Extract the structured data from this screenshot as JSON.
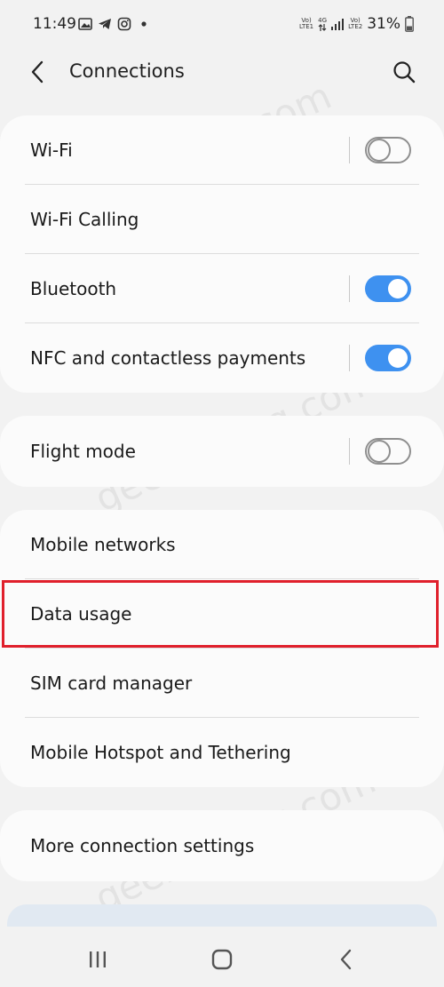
{
  "status_bar": {
    "time": "11:49",
    "net1_top": "Vo)",
    "net1_bottom": "LTE1",
    "net_type": "4G",
    "net2_top": "Vo)",
    "net2_bottom": "LTE2",
    "battery_percent": "31%"
  },
  "header": {
    "title": "Connections"
  },
  "groups": [
    {
      "items": [
        {
          "label": "Wi-Fi",
          "toggle": false
        },
        {
          "label": "Wi-Fi Calling"
        },
        {
          "label": "Bluetooth",
          "toggle": true
        },
        {
          "label": "NFC and contactless payments",
          "toggle": true
        }
      ]
    },
    {
      "items": [
        {
          "label": "Flight mode",
          "toggle": false
        }
      ]
    },
    {
      "items": [
        {
          "label": "Mobile networks"
        },
        {
          "label": "Data usage",
          "highlighted": true
        },
        {
          "label": "SIM card manager"
        },
        {
          "label": "Mobile Hotspot and Tethering"
        }
      ]
    },
    {
      "items": [
        {
          "label": "More connection settings"
        }
      ]
    }
  ],
  "watermark": "geekermag.com",
  "colors": {
    "toggle_on": "#3e91f0",
    "highlight_border": "#e0202c",
    "background": "#f2f2f2",
    "card": "#fbfbfb"
  },
  "icons": [
    "image-icon",
    "telegram-icon",
    "instagram-icon",
    "dot-icon",
    "signal-icon",
    "battery-icon",
    "back-arrow-icon",
    "search-icon",
    "recents-icon",
    "home-icon",
    "back-nav-icon"
  ]
}
